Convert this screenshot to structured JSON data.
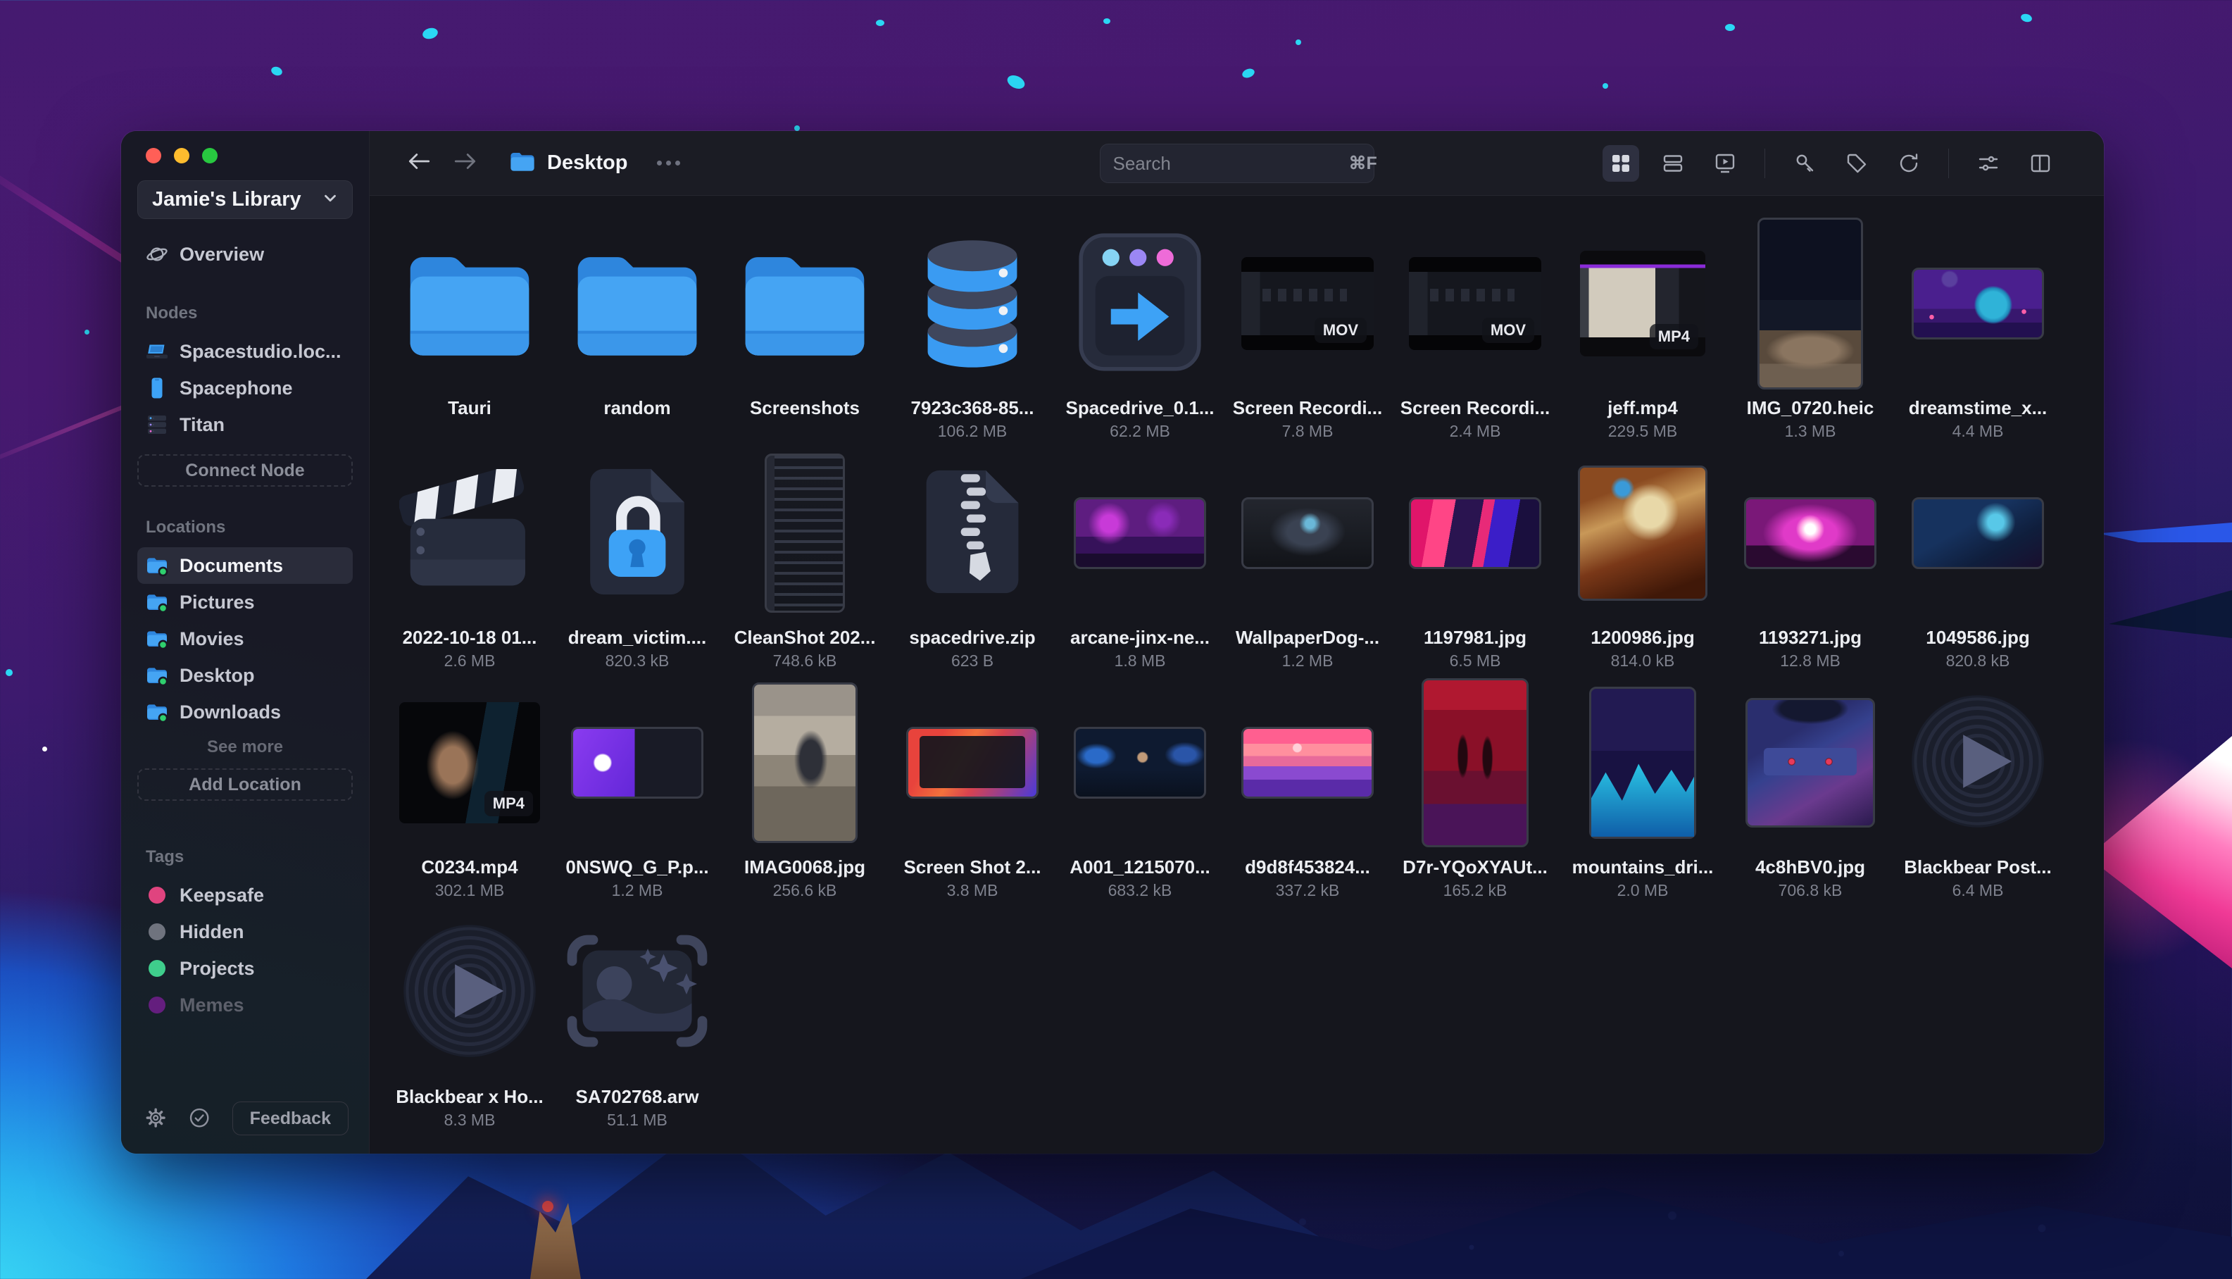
{
  "window": {
    "controls": [
      "close-button",
      "minimize-button",
      "zoom-button"
    ]
  },
  "sidebar": {
    "library": {
      "name": "Jamie's Library",
      "chevron_icon": "chevron-down-icon"
    },
    "overview_label": "Overview",
    "nodes": {
      "title": "Nodes",
      "items": [
        {
          "label": "Spacestudio.loc...",
          "icon": "laptop"
        },
        {
          "label": "Spacephone",
          "icon": "phone"
        },
        {
          "label": "Titan",
          "icon": "server"
        }
      ],
      "connect_label": "Connect Node"
    },
    "locations": {
      "title": "Locations",
      "items": [
        {
          "label": "Documents",
          "active": true
        },
        {
          "label": "Pictures",
          "active": false
        },
        {
          "label": "Movies",
          "active": false
        },
        {
          "label": "Desktop",
          "active": false
        },
        {
          "label": "Downloads",
          "active": false
        }
      ],
      "see_more_label": "See more",
      "add_label": "Add Location"
    },
    "tags": {
      "title": "Tags",
      "items": [
        {
          "label": "Keepsafe",
          "color": "#e0447f",
          "dimmed": false
        },
        {
          "label": "Hidden",
          "color": "#6f737e",
          "dimmed": false
        },
        {
          "label": "Projects",
          "color": "#3fce8c",
          "dimmed": false
        },
        {
          "label": "Memes",
          "color": "#641e7e",
          "dimmed": true
        }
      ]
    },
    "footer": {
      "icons": [
        "gear-icon",
        "check-circle-icon"
      ],
      "feedback_label": "Feedback"
    }
  },
  "topbar": {
    "nav_icons": [
      "back-arrow-icon",
      "forward-arrow-icon"
    ],
    "path": {
      "icon": "folder-icon",
      "label": "Desktop",
      "more_icon": "ellipsis-icon"
    },
    "search": {
      "placeholder": "Search",
      "shortcut": "⌘F"
    },
    "view_icons": [
      "grid-view-icon",
      "list-view-icon",
      "media-view-icon"
    ],
    "action_icons": [
      "key-icon",
      "tag-icon",
      "refresh-icon"
    ],
    "panel_icons": [
      "filters-icon",
      "sidebar-panel-icon"
    ]
  },
  "grid": {
    "items": [
      {
        "name": "Tauri",
        "size": "",
        "kind": "folder"
      },
      {
        "name": "random",
        "size": "",
        "kind": "folder"
      },
      {
        "name": "Screenshots",
        "size": "",
        "kind": "folder"
      },
      {
        "name": "7923c368-85...",
        "size": "106.2 MB",
        "kind": "database"
      },
      {
        "name": "Spacedrive_0.1...",
        "size": "62.2 MB",
        "kind": "dmg"
      },
      {
        "name": "Screen Recordi...",
        "size": "7.8 MB",
        "kind": "thumb",
        "thumb": "screenrec",
        "video": true,
        "badge": "MOV"
      },
      {
        "name": "Screen Recordi...",
        "size": "2.4 MB",
        "kind": "thumb",
        "thumb": "screenrec",
        "video": true,
        "badge": "MOV"
      },
      {
        "name": "jeff.mp4",
        "size": "229.5 MB",
        "kind": "thumb",
        "thumb": "jeff",
        "video": true,
        "badge": "MP4"
      },
      {
        "name": "IMG_0720.heic",
        "size": "1.3 MB",
        "kind": "thumb",
        "thumb": "img0720"
      },
      {
        "name": "dreamstime_x...",
        "size": "4.4 MB",
        "kind": "thumb",
        "thumb": "dreamstime"
      },
      {
        "name": "2022-10-18 01...",
        "size": "2.6 MB",
        "kind": "clapper"
      },
      {
        "name": "dream_victim....",
        "size": "820.3 kB",
        "kind": "lockdoc"
      },
      {
        "name": "CleanShot 202...",
        "size": "748.6 kB",
        "kind": "thumb",
        "thumb": "cleanshot"
      },
      {
        "name": "spacedrive.zip",
        "size": "623 B",
        "kind": "zip"
      },
      {
        "name": "arcane-jinx-ne...",
        "size": "1.8 MB",
        "kind": "thumb",
        "thumb": "jinx"
      },
      {
        "name": "WallpaperDog-...",
        "size": "1.2 MB",
        "kind": "thumb",
        "thumb": "wallpaperdog"
      },
      {
        "name": "1197981.jpg",
        "size": "6.5 MB",
        "kind": "thumb",
        "thumb": "p1197981"
      },
      {
        "name": "1200986.jpg",
        "size": "814.0 kB",
        "kind": "thumb",
        "thumb": "p1200986"
      },
      {
        "name": "1193271.jpg",
        "size": "12.8 MB",
        "kind": "thumb",
        "thumb": "p1193271"
      },
      {
        "name": "1049586.jpg",
        "size": "820.8 kB",
        "kind": "thumb",
        "thumb": "p1049586"
      },
      {
        "name": "C0234.mp4",
        "size": "302.1 MB",
        "kind": "thumb",
        "thumb": "c0234",
        "video": true,
        "badge": "MP4"
      },
      {
        "name": "0NSWQ_G_P.p...",
        "size": "1.2 MB",
        "kind": "thumb",
        "thumb": "onswq"
      },
      {
        "name": "IMAG0068.jpg",
        "size": "256.6 kB",
        "kind": "thumb",
        "thumb": "imag0068"
      },
      {
        "name": "Screen Shot 2...",
        "size": "3.8 MB",
        "kind": "thumb",
        "thumb": "screenshot2"
      },
      {
        "name": "A001_1215070...",
        "size": "683.2 kB",
        "kind": "thumb",
        "thumb": "a001"
      },
      {
        "name": "d9d8f453824...",
        "size": "337.2 kB",
        "kind": "thumb",
        "thumb": "d9d8"
      },
      {
        "name": "D7r-YQoXYAUt...",
        "size": "165.2 kB",
        "kind": "thumb",
        "thumb": "d7r"
      },
      {
        "name": "mountains_dri...",
        "size": "2.0 MB",
        "kind": "thumb",
        "thumb": "mountains"
      },
      {
        "name": "4c8hBV0.jpg",
        "size": "706.8 kB",
        "kind": "thumb",
        "thumb": "cassette"
      },
      {
        "name": "Blackbear Post...",
        "size": "6.4 MB",
        "kind": "vinyl"
      },
      {
        "name": "Blackbear x Ho...",
        "size": "8.3 MB",
        "kind": "vinyl"
      },
      {
        "name": "SA702768.arw",
        "size": "51.1 MB",
        "kind": "raw"
      }
    ]
  }
}
